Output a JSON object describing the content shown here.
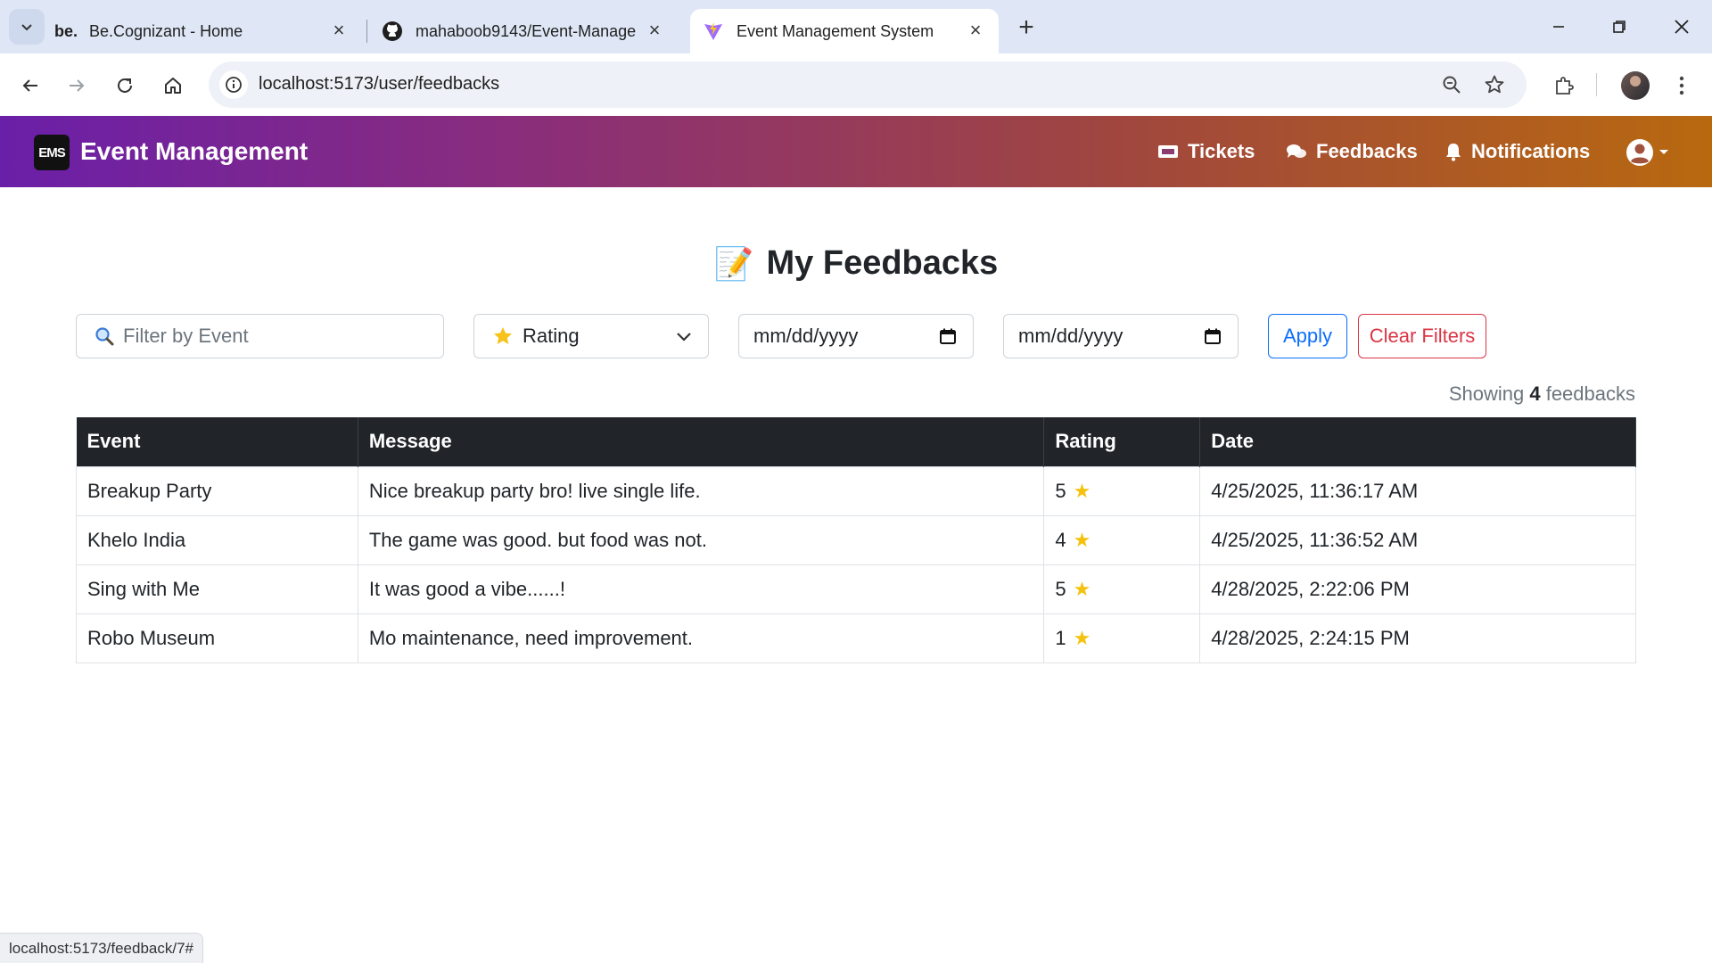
{
  "browser": {
    "tabs": [
      {
        "favicon": "be.",
        "title": "Be.Cognizant - Home"
      },
      {
        "favicon": "github-icon",
        "title": "mahaboob9143/Event-Manage"
      },
      {
        "favicon": "vite-icon",
        "title": "Event Management System"
      }
    ],
    "url": "localhost:5173/user/feedbacks",
    "status_url": "localhost:5173/feedback/7#"
  },
  "app": {
    "logo": "EMS",
    "brand": "Event Management",
    "nav": {
      "tickets": "Tickets",
      "feedbacks": "Feedbacks",
      "notifications": "Notifications"
    }
  },
  "page": {
    "title_emoji": "📝",
    "title": "My Feedbacks",
    "filters": {
      "event_placeholder": "Filter by Event",
      "rating_label": "Rating",
      "date_from": "mm/dd/yyyy",
      "date_to": "mm/dd/yyyy",
      "apply": "Apply",
      "clear": "Clear Filters"
    },
    "count": {
      "prefix": "Showing",
      "value": "4",
      "suffix": "feedbacks"
    }
  },
  "table": {
    "headers": [
      "Event",
      "Message",
      "Rating",
      "Date"
    ],
    "rows": [
      {
        "event": "Breakup Party",
        "message": "Nice breakup party bro! live single life.",
        "rating": "5",
        "date": "4/25/2025, 11:36:17 AM"
      },
      {
        "event": "Khelo India",
        "message": "The game was good. but food was not.",
        "rating": "4",
        "date": "4/25/2025, 11:36:52 AM"
      },
      {
        "event": "Sing with Me",
        "message": "It was good a vibe......!",
        "rating": "5",
        "date": "4/28/2025, 2:22:06 PM"
      },
      {
        "event": "Robo Museum",
        "message": "Mo maintenance, need improvement.",
        "rating": "1",
        "date": "4/28/2025, 2:24:15 PM"
      }
    ]
  },
  "colors": {
    "navbar_gradient_start": "#6a1fa8",
    "navbar_gradient_end": "#b8690f",
    "apply_blue": "#0d6efd",
    "clear_red": "#dc3545",
    "star": "#f4c20d"
  }
}
